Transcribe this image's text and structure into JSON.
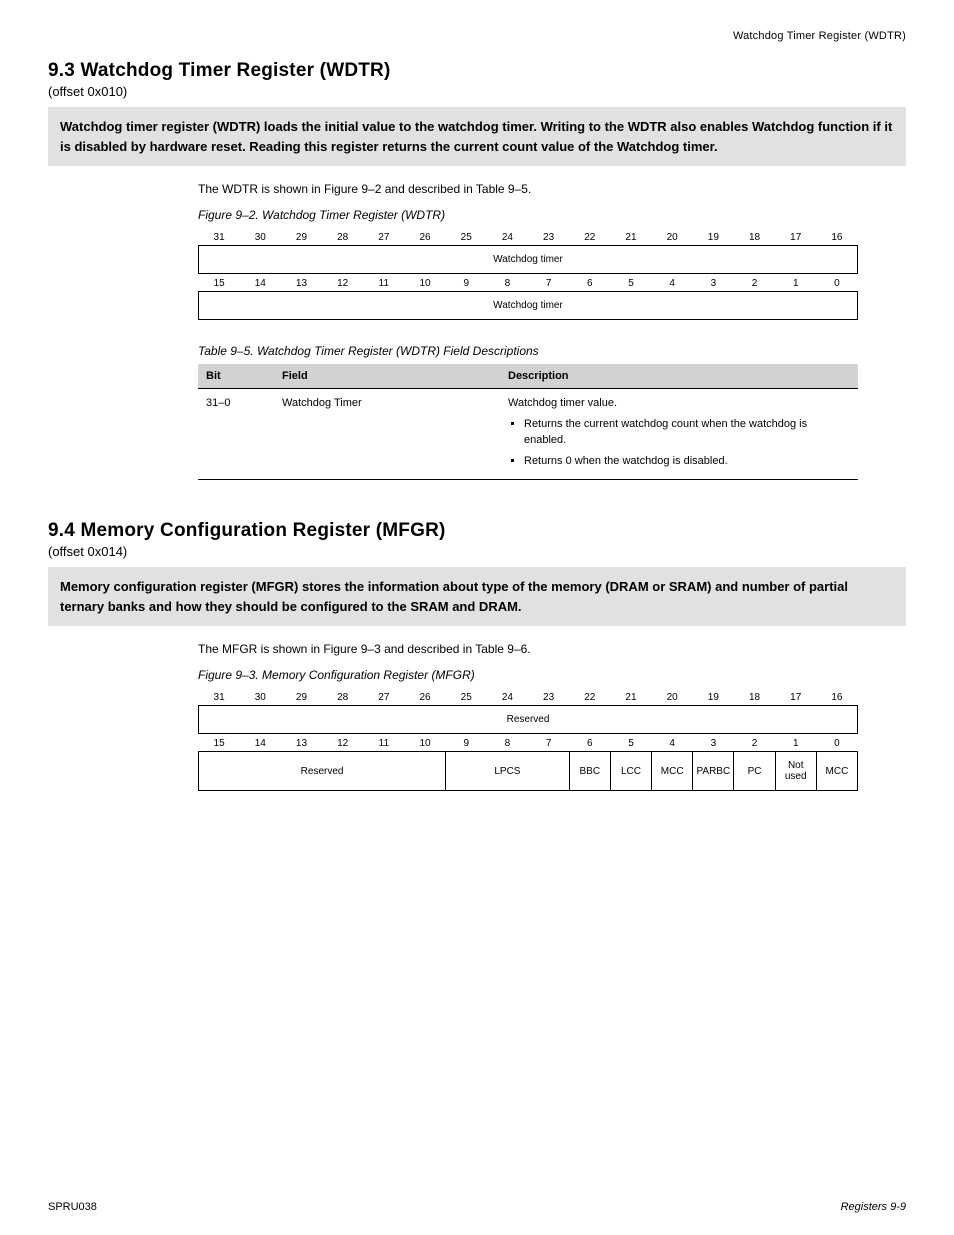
{
  "header": {
    "right_label": "Watchdog Timer Register (WDTR)"
  },
  "section1": {
    "number_title": "9.3 Watchdog Timer Register (WDTR)",
    "offset": "(offset 0x010)",
    "gray_note": "Watchdog timer register (WDTR) loads the initial value to the watchdog timer. Writing to the WDTR also enables Watchdog function if it is disabled by hardware reset. Reading this register returns the current count value of the Watchdog timer.",
    "note_line": "The WDTR is shown in Figure 9–2 and described in Table 9–5.",
    "figure_label": "Figure 9–2. Watchdog Timer Register (WDTR)",
    "bit_headers_high": [
      "31",
      "30",
      "29",
      "28",
      "27",
      "26",
      "25",
      "24",
      "23",
      "22",
      "21",
      "20",
      "19",
      "18",
      "17",
      "16"
    ],
    "bit_headers_low": [
      "15",
      "14",
      "13",
      "12",
      "11",
      "10",
      "9",
      "8",
      "7",
      "6",
      "5",
      "4",
      "3",
      "2",
      "1",
      "0"
    ],
    "field_high": "Watchdog timer",
    "field_low": "Watchdog timer",
    "table_label": "Table 9–5. Watchdog Timer Register (WDTR) Field Descriptions",
    "table_head": {
      "bits": "Bit",
      "field": "Field",
      "desc": "Description"
    },
    "rows": [
      {
        "bits": "31–0",
        "field": "Watchdog Timer",
        "desc_lead": "Watchdog timer value.",
        "bullets": [
          "Returns the current watchdog count when the watchdog is enabled.",
          "Returns 0 when the watchdog is disabled."
        ]
      }
    ]
  },
  "section2": {
    "number_title": "9.4 Memory Configuration Register (MFGR)",
    "offset": "(offset 0x014)",
    "gray_note": "Memory configuration register (MFGR) stores the information about type of the memory (DRAM or SRAM) and number of partial ternary banks and how they should be configured to the SRAM and DRAM.",
    "note_line": "The MFGR is shown in Figure 9–3 and described in Table 9–6.",
    "figure_label": "Figure 9–3. Memory Configuration Register (MFGR)",
    "bit_headers_high": [
      "31",
      "30",
      "29",
      "28",
      "27",
      "26",
      "25",
      "24",
      "23",
      "22",
      "21",
      "20",
      "19",
      "18",
      "17",
      "16"
    ],
    "bit_headers_low": [
      "15",
      "14",
      "13",
      "12",
      "11",
      "10",
      "9",
      "8",
      "7",
      "6",
      "5",
      "4",
      "3",
      "2",
      "1",
      "0"
    ],
    "field_high": "Reserved",
    "low_fields": {
      "reserved": "Reserved",
      "lpcs": "LPCS",
      "bbc": "BBC",
      "lcc": "LCC",
      "mcc4": "MCC",
      "parbc": "PARBC",
      "pc": "PC",
      "notused": "Not used",
      "mcc0": "MCC"
    }
  },
  "footer": {
    "left": "SPRU038",
    "right": "Registers    9-9"
  }
}
